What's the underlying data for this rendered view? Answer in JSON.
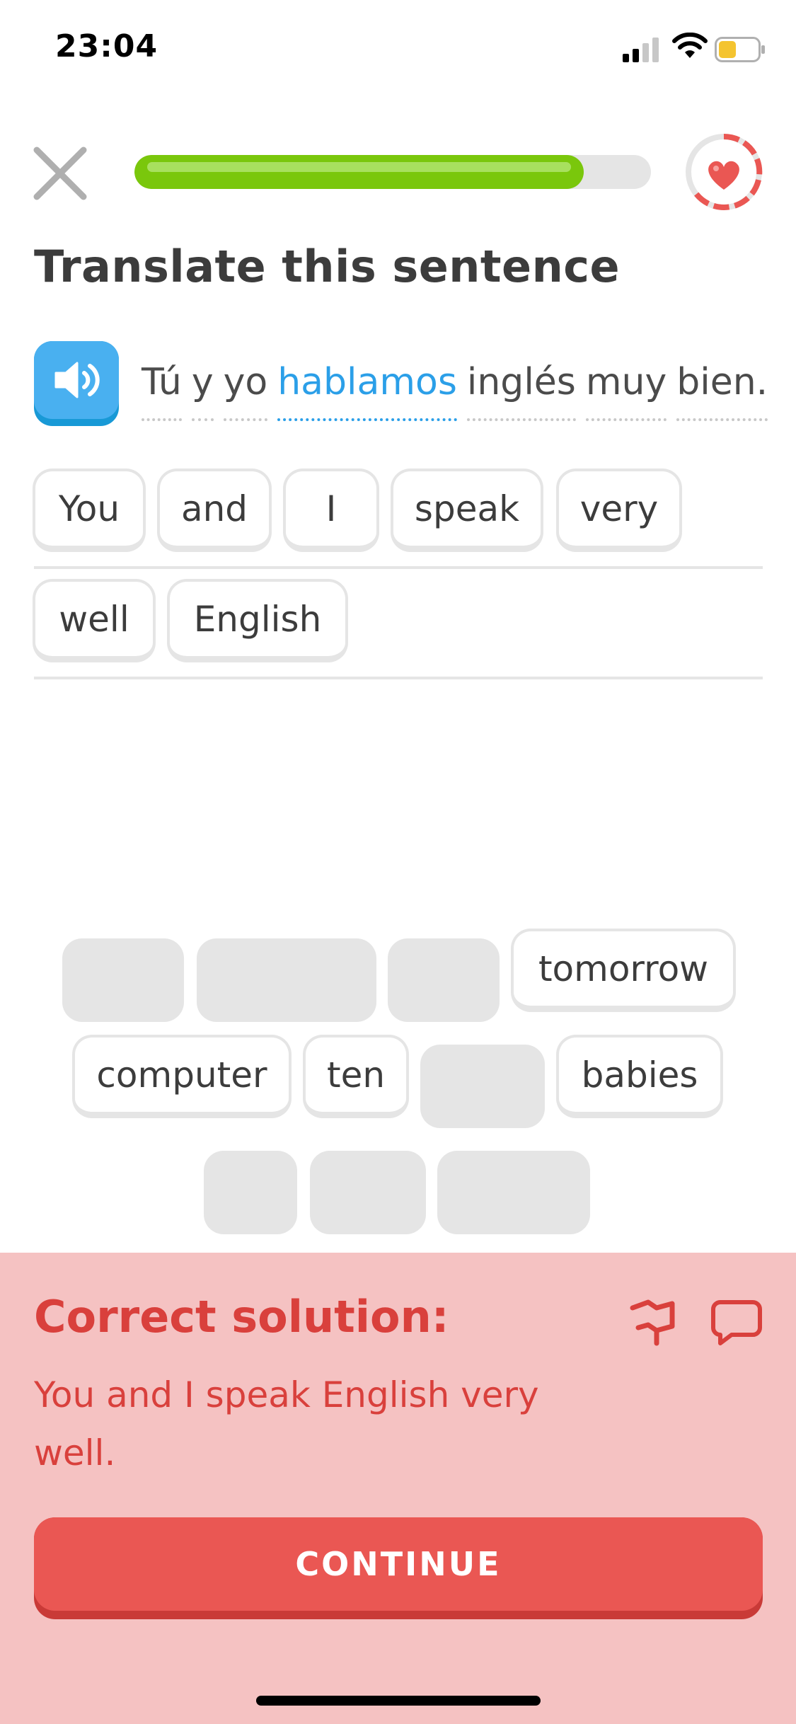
{
  "status_bar": {
    "time": "23:04"
  },
  "header": {
    "progress": 0.87
  },
  "instruction": "Translate this sentence",
  "prompt_words": [
    "Tú",
    "y",
    "yo",
    "hablamos",
    "inglés",
    "muy",
    "bien."
  ],
  "answer_row1": [
    "You",
    "and",
    "I",
    "speak",
    "very"
  ],
  "answer_row2": [
    "well",
    "English"
  ],
  "bank_words": [
    "tomorrow",
    "computer",
    "ten",
    "babies"
  ],
  "feedback": {
    "title": "Correct solution:",
    "answer": "You and I speak English very well.",
    "continue_label": "CONTINUE"
  },
  "colors": {
    "accent_green": "#7ac70c",
    "accent_blue": "#1899d6",
    "error_red": "#ea5753",
    "feedback_bg": "#f5c2c2"
  }
}
